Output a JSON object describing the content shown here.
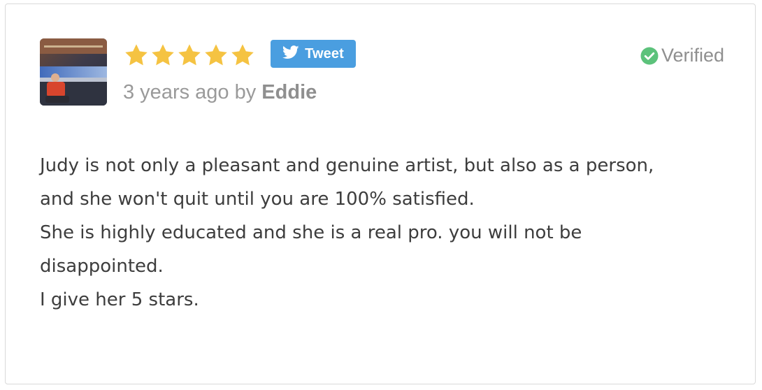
{
  "review": {
    "avatar_icon": "reviewer-photo",
    "rating": 5,
    "rating_max": 5,
    "star_color": "#f5c342",
    "tweet_label": "Tweet",
    "tweet_icon": "twitter-bird-icon",
    "tweet_color": "#4a9ee0",
    "time_text": "3 years ago by ",
    "author": "Eddie",
    "verified_label": "Verified",
    "verified_icon": "check-circle-icon",
    "verified_color": "#5cc27b",
    "body_lines": [
      "Judy is not only a pleasant and genuine artist, but also as a person,",
      "and she won't quit until you are 100% satisfied.",
      "She is highly educated and she is a real pro. you will not be",
      "disappointed.",
      "I give her 5 stars."
    ]
  }
}
